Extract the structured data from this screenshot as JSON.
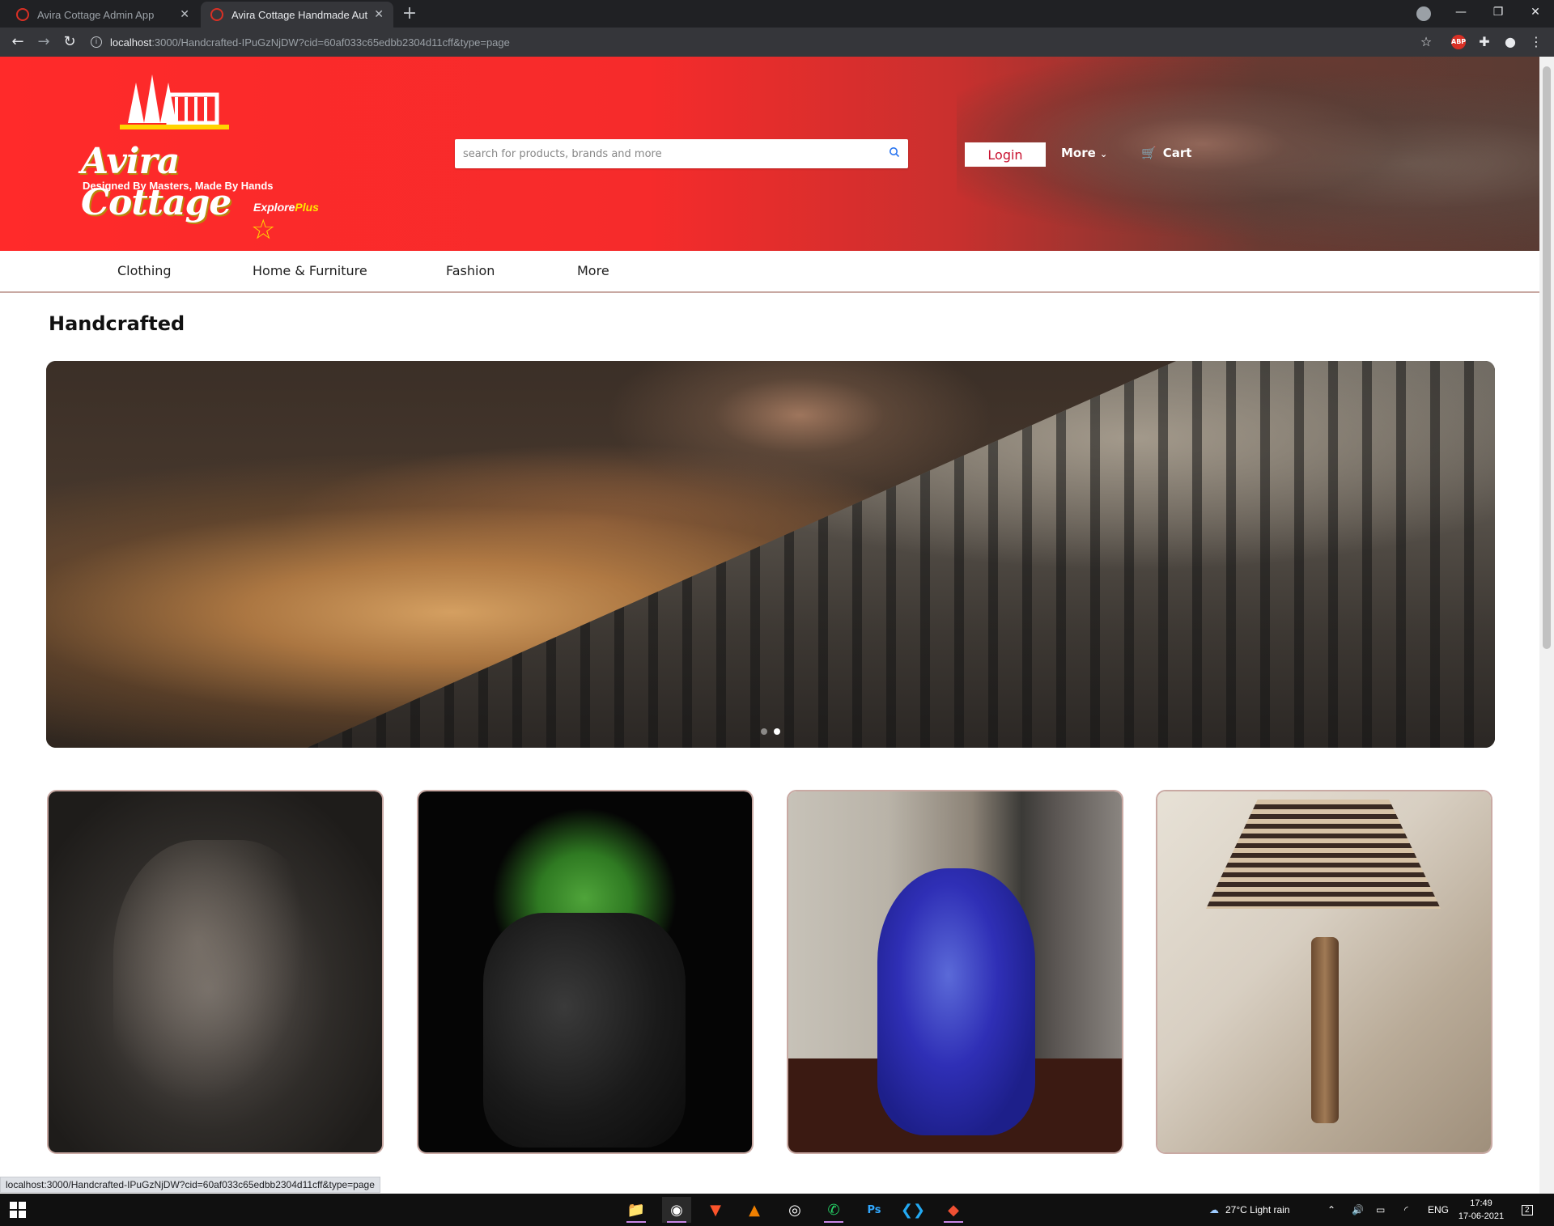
{
  "browser": {
    "tabs": [
      {
        "title": "Avira Cottage Admin App",
        "active": false
      },
      {
        "title": "Avira Cottage Handmade Authen",
        "active": true
      }
    ],
    "url_host": "localhost",
    "url_path": ":3000/Handcrafted-IPuGzNjDW?cid=60af033c65edbb2304d11cff&type=page",
    "abp_label": "ABP"
  },
  "site": {
    "logo_name": "Avira Cottage",
    "logo_tagline": "Designed By Masters, Made By Hands",
    "explore": "Explore",
    "explore_plus": "Plus",
    "search_placeholder": "search for products, brands and more",
    "login": "Login",
    "more": "More",
    "cart": "Cart",
    "categories": [
      "Clothing",
      "Home & Furniture",
      "Fashion",
      "More"
    ],
    "page_title": "Handcrafted",
    "carousel": {
      "slides": 2,
      "active_index": 1
    },
    "products": [
      {
        "name": "carved-elephant"
      },
      {
        "name": "face-planter"
      },
      {
        "name": "blue-painted-vase"
      },
      {
        "name": "wooden-hut-lamp"
      }
    ]
  },
  "status_url": "localhost:3000/Handcrafted-IPuGzNjDW?cid=60af033c65edbb2304d11cff&type=page",
  "taskbar": {
    "weather": "27°C  Light rain",
    "lang": "ENG",
    "time": "17:49",
    "date": "17-06-2021",
    "notifications": "2"
  },
  "colors": {
    "brand_red": "#ff2a2a",
    "link_blue": "#2874f0"
  }
}
